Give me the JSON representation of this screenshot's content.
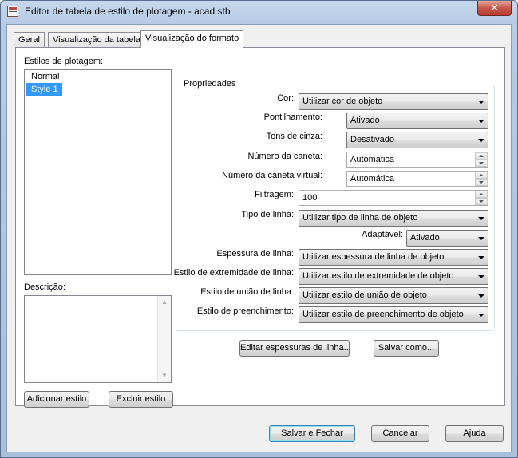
{
  "window": {
    "title": "Editor de tabela de estilo de plotagem - acad.stb",
    "close_glyph": "✕"
  },
  "tabs": [
    {
      "label": "Geral"
    },
    {
      "label": "Visualização da tabela"
    },
    {
      "label": "Visualização do formato",
      "active": true
    }
  ],
  "styles": {
    "label": "Estilos de plotagem:",
    "items": [
      "Normal",
      "Style 1"
    ],
    "selected": "Style 1"
  },
  "description": {
    "label": "Descrição:"
  },
  "left_buttons": {
    "add": "Adicionar estilo",
    "delete": "Excluir estilo"
  },
  "properties": {
    "title": "Propriedades",
    "cor": {
      "label": "Cor:",
      "value": "Utilizar cor de objeto"
    },
    "pontilhamento": {
      "label": "Pontilhamento:",
      "value": "Ativado"
    },
    "tons_cinza": {
      "label": "Tons de cinza:",
      "value": "Desativado"
    },
    "numero_caneta": {
      "label": "Número da caneta:",
      "value": "Automática"
    },
    "numero_caneta_virtual": {
      "label": "Número da caneta virtual:",
      "value": "Automática"
    },
    "filtragem": {
      "label": "Filtragem:",
      "value": "100"
    },
    "tipo_linha": {
      "label": "Tipo de linha:",
      "value": "Utilizar tipo de linha de objeto"
    },
    "adaptavel": {
      "label": "Adaptável:",
      "value": "Ativado"
    },
    "espessura": {
      "label": "Espessura de linha:",
      "value": "Utilizar espessura de linha de objeto"
    },
    "extremidade": {
      "label": "Estilo de extremidade de linha:",
      "value": "Utilizar estilo de extremidade de objeto"
    },
    "uniao": {
      "label": "Estilo de união de linha:",
      "value": "Utilizar estilo de união de objeto"
    },
    "preenchimento": {
      "label": "Estilo de preenchimento:",
      "value": "Utilizar estilo de preenchimento de objeto"
    }
  },
  "panel_buttons": {
    "edit_lineweights": "Editar espessuras de linha...",
    "save_as": "Salvar como..."
  },
  "footer": {
    "save_close": "Salvar e Fechar",
    "cancel": "Cancelar",
    "help": "Ajuda"
  },
  "colors": {
    "selection": "#3399ff",
    "close_button": "#c7574a",
    "title_bar": "#b6cbe4",
    "dialog_bg": "#f0f0f0"
  }
}
